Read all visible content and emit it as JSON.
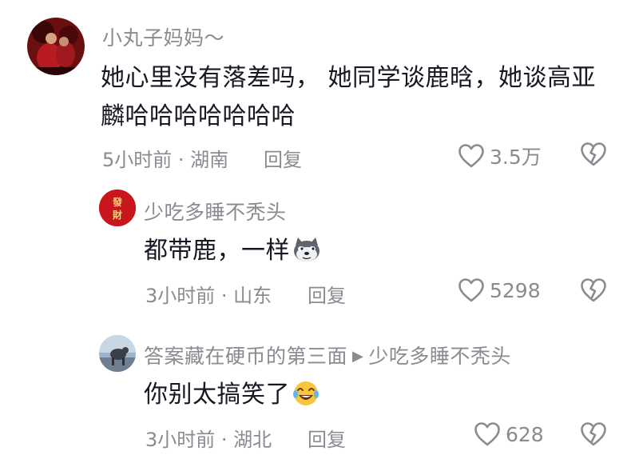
{
  "comments": [
    {
      "username": "小丸子妈妈～",
      "content_line1": "她心里没有落差吗， 她同学谈鹿晗，她谈高亚",
      "content_line2": "麟哈哈哈哈哈哈哈",
      "meta": "5小时前 · 湖南",
      "reply_label": "回复",
      "likes": "3.5万"
    },
    {
      "username": "少吃多睡不秃头",
      "avatar_text": "發財",
      "content": "都带鹿，一样",
      "meta": "3小时前 · 山东",
      "reply_label": "回复",
      "likes": "5298"
    },
    {
      "username": "答案藏在硬币的第三面",
      "reply_to": "少吃多睡不秃头",
      "content": "你别太搞笑了",
      "meta": "3小时前 · 湖北",
      "reply_label": "回复",
      "likes": "628"
    }
  ],
  "icons": {
    "like": "heart-outline-icon",
    "dislike": "broken-heart-icon",
    "reply_arrow": "triangle-right-icon",
    "emoji_dog": "doge-emoji-icon",
    "emoji_laugh": "laugh-crying-emoji-icon"
  },
  "colors": {
    "text_primary": "#161823",
    "text_secondary": "#8a8b91",
    "avatar_fa_cai": "#c8161d"
  }
}
